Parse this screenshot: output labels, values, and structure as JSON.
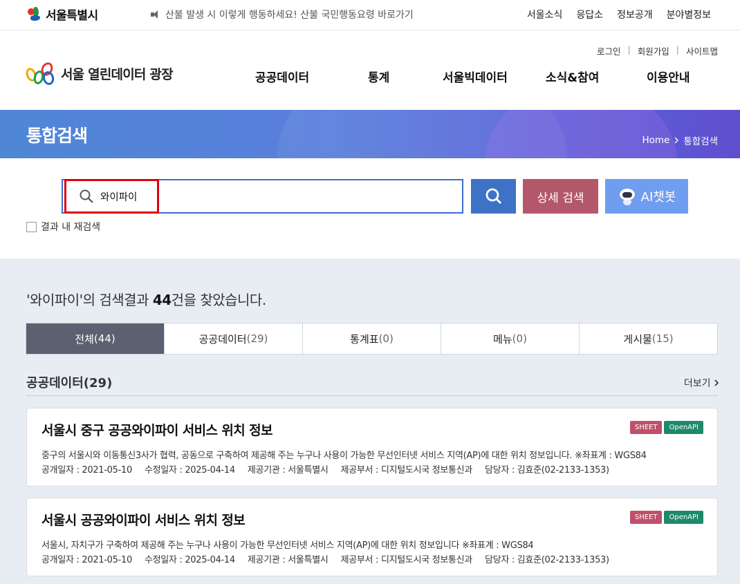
{
  "topbar": {
    "seoul_logo": "서울특별시",
    "notice": "산불 발생 시 이렇게 행동하세요! 산불 국민행동요령 바로가기",
    "links": [
      "서울소식",
      "응답소",
      "정보공개",
      "분야별정보"
    ]
  },
  "header": {
    "util_links": [
      "로그인",
      "회원가입",
      "사이트맵"
    ],
    "portal_name": "서울 열린데이터 광장",
    "nav": [
      "공공데이터",
      "통계",
      "서울빅데이터",
      "소식&참여",
      "이용안내"
    ]
  },
  "banner": {
    "title": "통합검색",
    "breadcrumb": [
      "Home",
      "통합검색"
    ]
  },
  "search": {
    "value": "와이파이",
    "detail_button": "상세 검색",
    "ai_button": "AI챗봇",
    "recheck_label": "결과 내 재검색"
  },
  "results": {
    "summary_query": "'와이파이'",
    "summary_mid": "의 검색결과 ",
    "summary_count": "44",
    "summary_tail": "건을 찾았습니다.",
    "tabs": [
      {
        "label": "전체",
        "count": "(44)"
      },
      {
        "label": "공공데이터",
        "count": "(29)"
      },
      {
        "label": "통계표",
        "count": "(0)"
      },
      {
        "label": "메뉴",
        "count": "(0)"
      },
      {
        "label": "게시물",
        "count": "(15)"
      }
    ],
    "section_title": "공공데이터(29)",
    "more_label": "더보기",
    "items": [
      {
        "title": "서울시 중구 공공와이파이 서비스 위치 정보",
        "badges": [
          "SHEET",
          "OpenAPI"
        ],
        "desc": "중구의 서울시와 이동통신3사가 협력, 공동으로 구축하여 제공해 주는 누구나 사용이 가능한 무선인터넷 서비스 지역(AP)에 대한 위치 정보입니다. ※좌표계 : WGS84",
        "meta": [
          "공개일자 : 2021-05-10",
          "수정일자 : 2025-04-14",
          "제공기관 : 서울특별시",
          "제공부서 : 디지털도시국 정보통신과",
          "담당자 : 김효준(02-2133-1353)"
        ]
      },
      {
        "title": "서울시 공공와이파이 서비스 위치 정보",
        "badges": [
          "SHEET",
          "OpenAPI"
        ],
        "desc": "서울시, 자치구가 구축하여 제공해 주는 누구나 사용이 가능한 무선인터넷 서비스 지역(AP)에 대한 위치 정보입니다 ※좌표계 : WGS84",
        "meta": [
          "공개일자 : 2021-05-10",
          "수정일자 : 2025-04-14",
          "제공기관 : 서울특별시",
          "제공부서 : 디지털도시국 정보통신과",
          "담당자 : 김효준(02-2133-1353)"
        ]
      }
    ]
  },
  "colors": {
    "highlight_box": "#e0000f",
    "search_border": "#3b6dc9",
    "active_tab": "#5b6170",
    "sheet_badge": "#c0506a",
    "openapi_badge": "#1e8a6a"
  }
}
